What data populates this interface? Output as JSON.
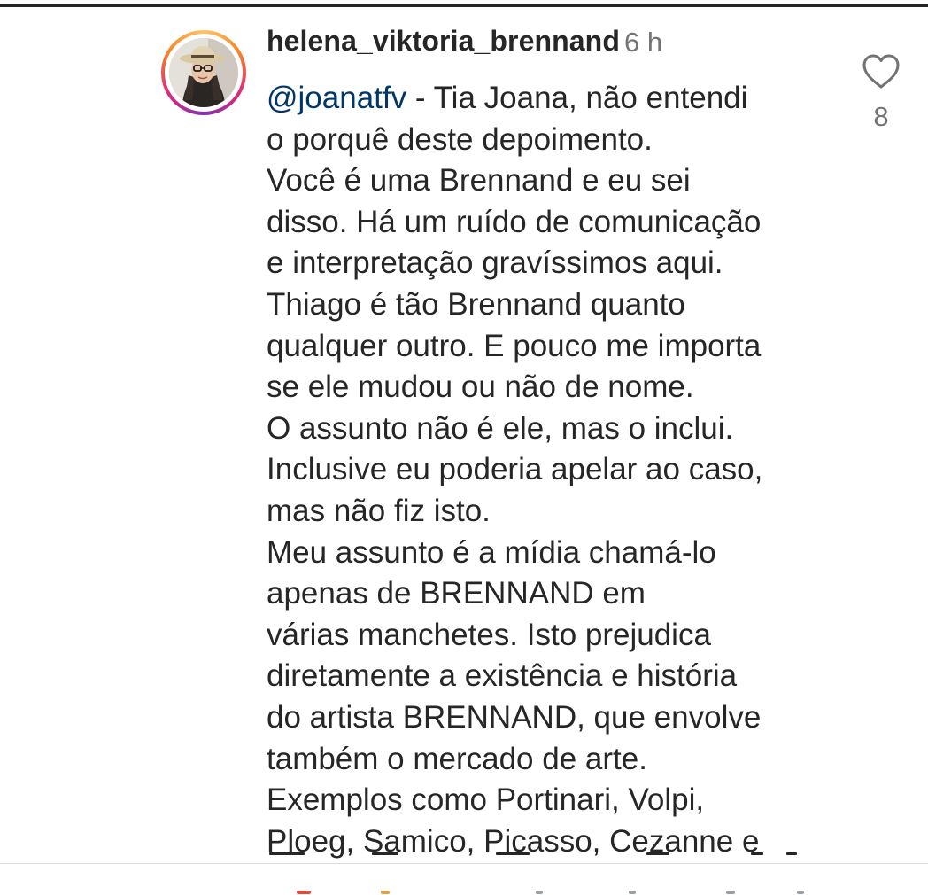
{
  "comment": {
    "username": "helena_viktoria_brennand",
    "time": "6 h",
    "mention": "@joanatfv",
    "first_line_rest": " - Tia Joana, não entendi",
    "lines": [
      "o porquê deste depoimento.",
      "Você é uma Brennand e eu sei",
      "disso. Há um ruído de comunicação",
      "e interpretação gravíssimos aqui.",
      "Thiago é tão Brennand quanto",
      "qualquer outro. E pouco me importa",
      "se ele mudou ou não de nome.",
      "O assunto não é ele, mas o inclui.",
      "Inclusive eu poderia apelar ao caso,",
      "mas não fiz isto.",
      "Meu assunto é a mídia chamá-lo",
      "apenas de BRENNAND em",
      "várias manchetes. Isto prejudica",
      "diretamente a existência e história",
      "do artista BRENNAND, que envolve",
      "também o mercado de arte.",
      "Exemplos como Portinari, Volpi,",
      "Ploeg, Samico, Picasso, Cezanne e"
    ],
    "like_count": "8",
    "icons": {
      "like": "heart-outline-icon",
      "avatar": "profile-avatar"
    },
    "colors": {
      "mention": "#00376b",
      "secondary_text": "#737373",
      "text": "#262626"
    }
  }
}
